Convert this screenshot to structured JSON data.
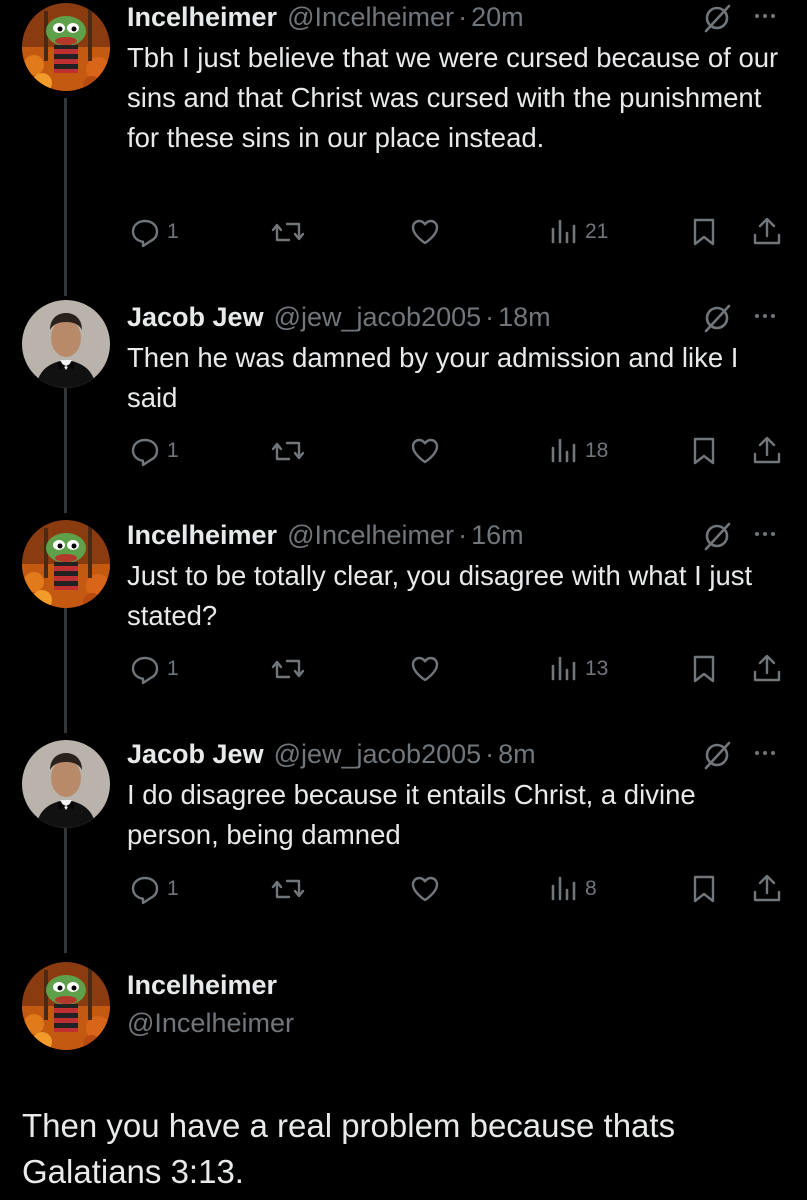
{
  "colors": {
    "background": "#000000",
    "text": "#e7e9ea",
    "secondary": "#71767b",
    "thread_line": "#333639"
  },
  "tweets": [
    {
      "name": "Incelheimer",
      "handle": "@Incelheimer",
      "dot": "·",
      "time": "20m",
      "text": "Tbh I just believe that we were cursed because of our sins and that Christ was cursed with the punishment for these sins in our place instead.",
      "replies": "1",
      "views": "21",
      "avatar": "pepe-autumn-avatar"
    },
    {
      "name": "Jacob Jew",
      "handle": "@jew_jacob2005",
      "dot": "·",
      "time": "18m",
      "text": "Then he was damned by your admission and like I said",
      "replies": "1",
      "views": "18",
      "avatar": "tuxedo-portrait-avatar"
    },
    {
      "name": "Incelheimer",
      "handle": "@Incelheimer",
      "dot": "·",
      "time": "16m",
      "text": "Just to be totally clear, you disagree with what I just stated?",
      "replies": "1",
      "views": "13",
      "avatar": "pepe-autumn-avatar"
    },
    {
      "name": "Jacob Jew",
      "handle": "@jew_jacob2005",
      "dot": "·",
      "time": "8m",
      "text": "I do disagree because it entails Christ, a divine person, being damned",
      "replies": "1",
      "views": "8",
      "avatar": "tuxedo-portrait-avatar"
    }
  ],
  "main_tweet": {
    "name": "Incelheimer",
    "handle": "@Incelheimer",
    "text": "Then you have a real problem because thats Galatians 3:13.",
    "avatar": "pepe-autumn-avatar"
  },
  "icons": {
    "reply": "reply-icon",
    "retweet": "retweet-icon",
    "like": "heart-icon",
    "views": "views-icon",
    "bookmark": "bookmark-icon",
    "share": "share-icon",
    "grok": "grok-icon",
    "more": "more-icon"
  }
}
